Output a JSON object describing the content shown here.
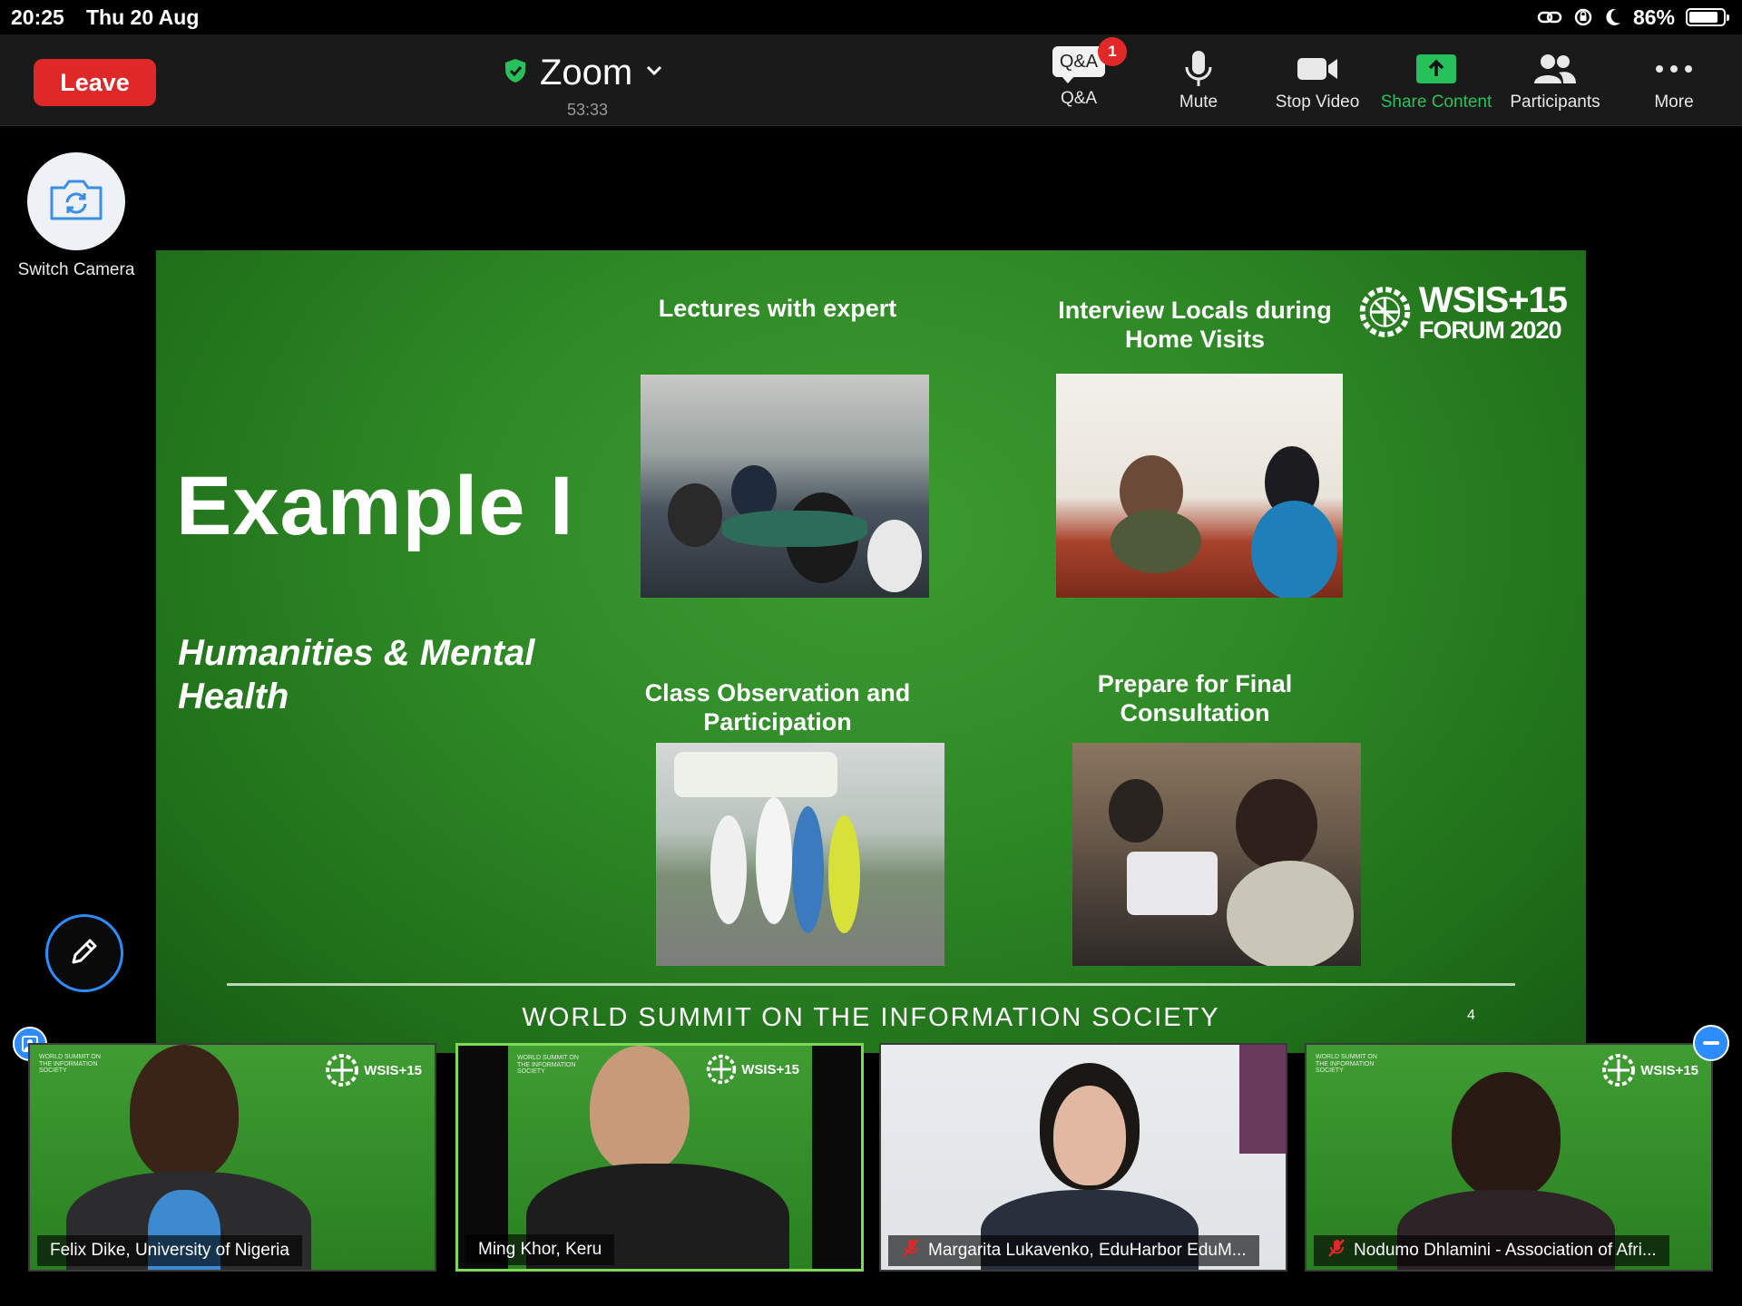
{
  "status_bar": {
    "time": "20:25",
    "date": "Thu 20 Aug",
    "battery_percent_label": "86%",
    "battery_level": 0.86,
    "icons": [
      "link-icon",
      "orientation-lock-icon",
      "do-not-disturb-moon-icon",
      "battery-icon"
    ]
  },
  "toolbar": {
    "leave_label": "Leave",
    "meeting_title": "Zoom",
    "timer": "53:33",
    "tools": {
      "qa": {
        "icon_text": "Q&A",
        "badge": "1",
        "label": "Q&A"
      },
      "mute": {
        "label": "Mute"
      },
      "stop_video": {
        "label": "Stop Video"
      },
      "share": {
        "label": "Share Content"
      },
      "participants": {
        "label": "Participants"
      },
      "more": {
        "label": "More"
      }
    },
    "colors": {
      "leave": "#e02828",
      "share_accent": "#27c15b",
      "encryption_shield": "#27c15b"
    }
  },
  "sidebar": {
    "switch_camera_label": "Switch Camera"
  },
  "slide": {
    "title": "Example I",
    "subtitle": "Humanities & Mental Health",
    "captions": [
      "Lectures with expert",
      "Interview Locals during Home Visits",
      "Class Observation and Participation",
      "Prepare for Final Consultation"
    ],
    "logo": {
      "line1": "WSIS+15",
      "line2": "FORUM 2020"
    },
    "footer": "WORLD SUMMIT ON THE INFORMATION SOCIETY",
    "page_number": "4",
    "background": "#2f8a26"
  },
  "participants": [
    {
      "name": "Felix Dike, University of Nigeria",
      "muted": false,
      "active": false
    },
    {
      "name": "Ming Khor, Keru",
      "muted": false,
      "active": true
    },
    {
      "name": "Margarita Lukavenko, EduHarbor EduM...",
      "muted": true,
      "active": false
    },
    {
      "name": "Nodumo Dhlamini - Association of Afri...",
      "muted": true,
      "active": false
    }
  ],
  "tile_background_text": {
    "summit_small": "WORLD SUMMIT ON THE INFORMATION SOCIETY",
    "logo_small": "WSIS+15"
  }
}
